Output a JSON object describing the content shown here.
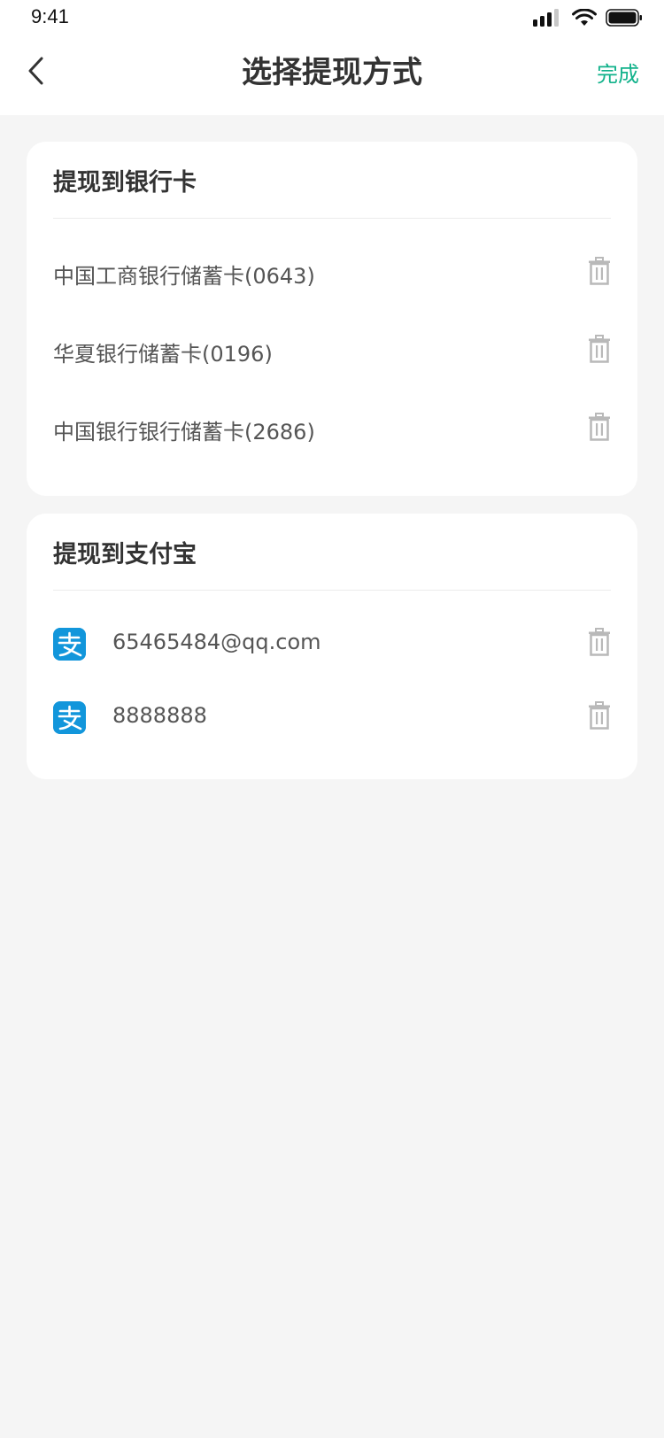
{
  "status_bar": {
    "time": "9:41"
  },
  "nav": {
    "title": "选择提现方式",
    "done_label": "完成"
  },
  "bank_section": {
    "title": "提现到银行卡",
    "items": [
      {
        "label": "中国工商银行储蓄卡(0643)"
      },
      {
        "label": "华夏银行储蓄卡(0196)"
      },
      {
        "label": "中国银行银行储蓄卡(2686)"
      }
    ]
  },
  "alipay_section": {
    "title": "提现到支付宝",
    "items": [
      {
        "label": "65465484@qq.com",
        "icon": "alipay-icon"
      },
      {
        "label": "8888888",
        "icon": "alipay-icon"
      }
    ]
  },
  "colors": {
    "accent": "#12b28b",
    "alipay": "#1296db",
    "background": "#f5f5f5"
  }
}
